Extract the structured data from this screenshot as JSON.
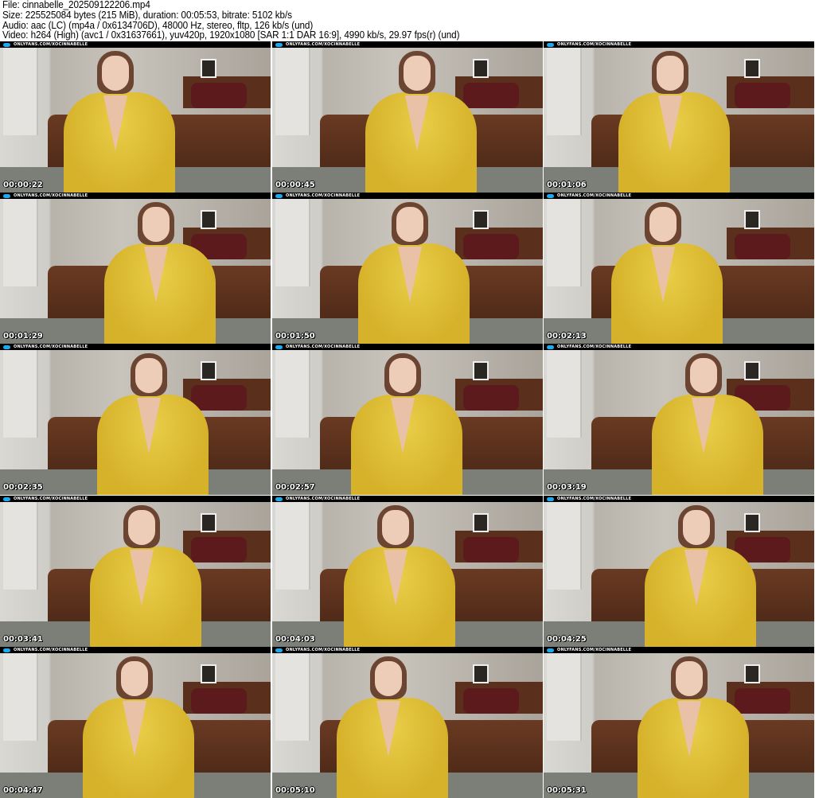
{
  "header": {
    "file": "File: cinnabelle_202509122206.mp4",
    "size": "Size: 225525084 bytes (215 MiB), duration: 00:05:53, bitrate: 5102 kb/s",
    "audio": "Audio: aac (LC) (mp4a / 0x6134706D), 48000 Hz, stereo, fltp, 126 kb/s (und)",
    "video": "Video: h264 (High) (avc1 / 0x31637661), yuv420p, 1920x1080 [SAR 1:1 DAR 16:9], 4990 kb/s, 29.97 fps(r) (und)"
  },
  "watermark": "ONLYFANS.COM/XOCINNABELLE",
  "accent": "#19aaf0",
  "thumbnails": [
    {
      "timestamp": "00:00:22"
    },
    {
      "timestamp": "00:00:45"
    },
    {
      "timestamp": "00:01:06"
    },
    {
      "timestamp": "00:01:29"
    },
    {
      "timestamp": "00:01:50"
    },
    {
      "timestamp": "00:02:13"
    },
    {
      "timestamp": "00:02:35"
    },
    {
      "timestamp": "00:02:57"
    },
    {
      "timestamp": "00:03:19"
    },
    {
      "timestamp": "00:03:41"
    },
    {
      "timestamp": "00:04:03"
    },
    {
      "timestamp": "00:04:25"
    },
    {
      "timestamp": "00:04:47"
    },
    {
      "timestamp": "00:05:10"
    },
    {
      "timestamp": "00:05:31"
    }
  ]
}
